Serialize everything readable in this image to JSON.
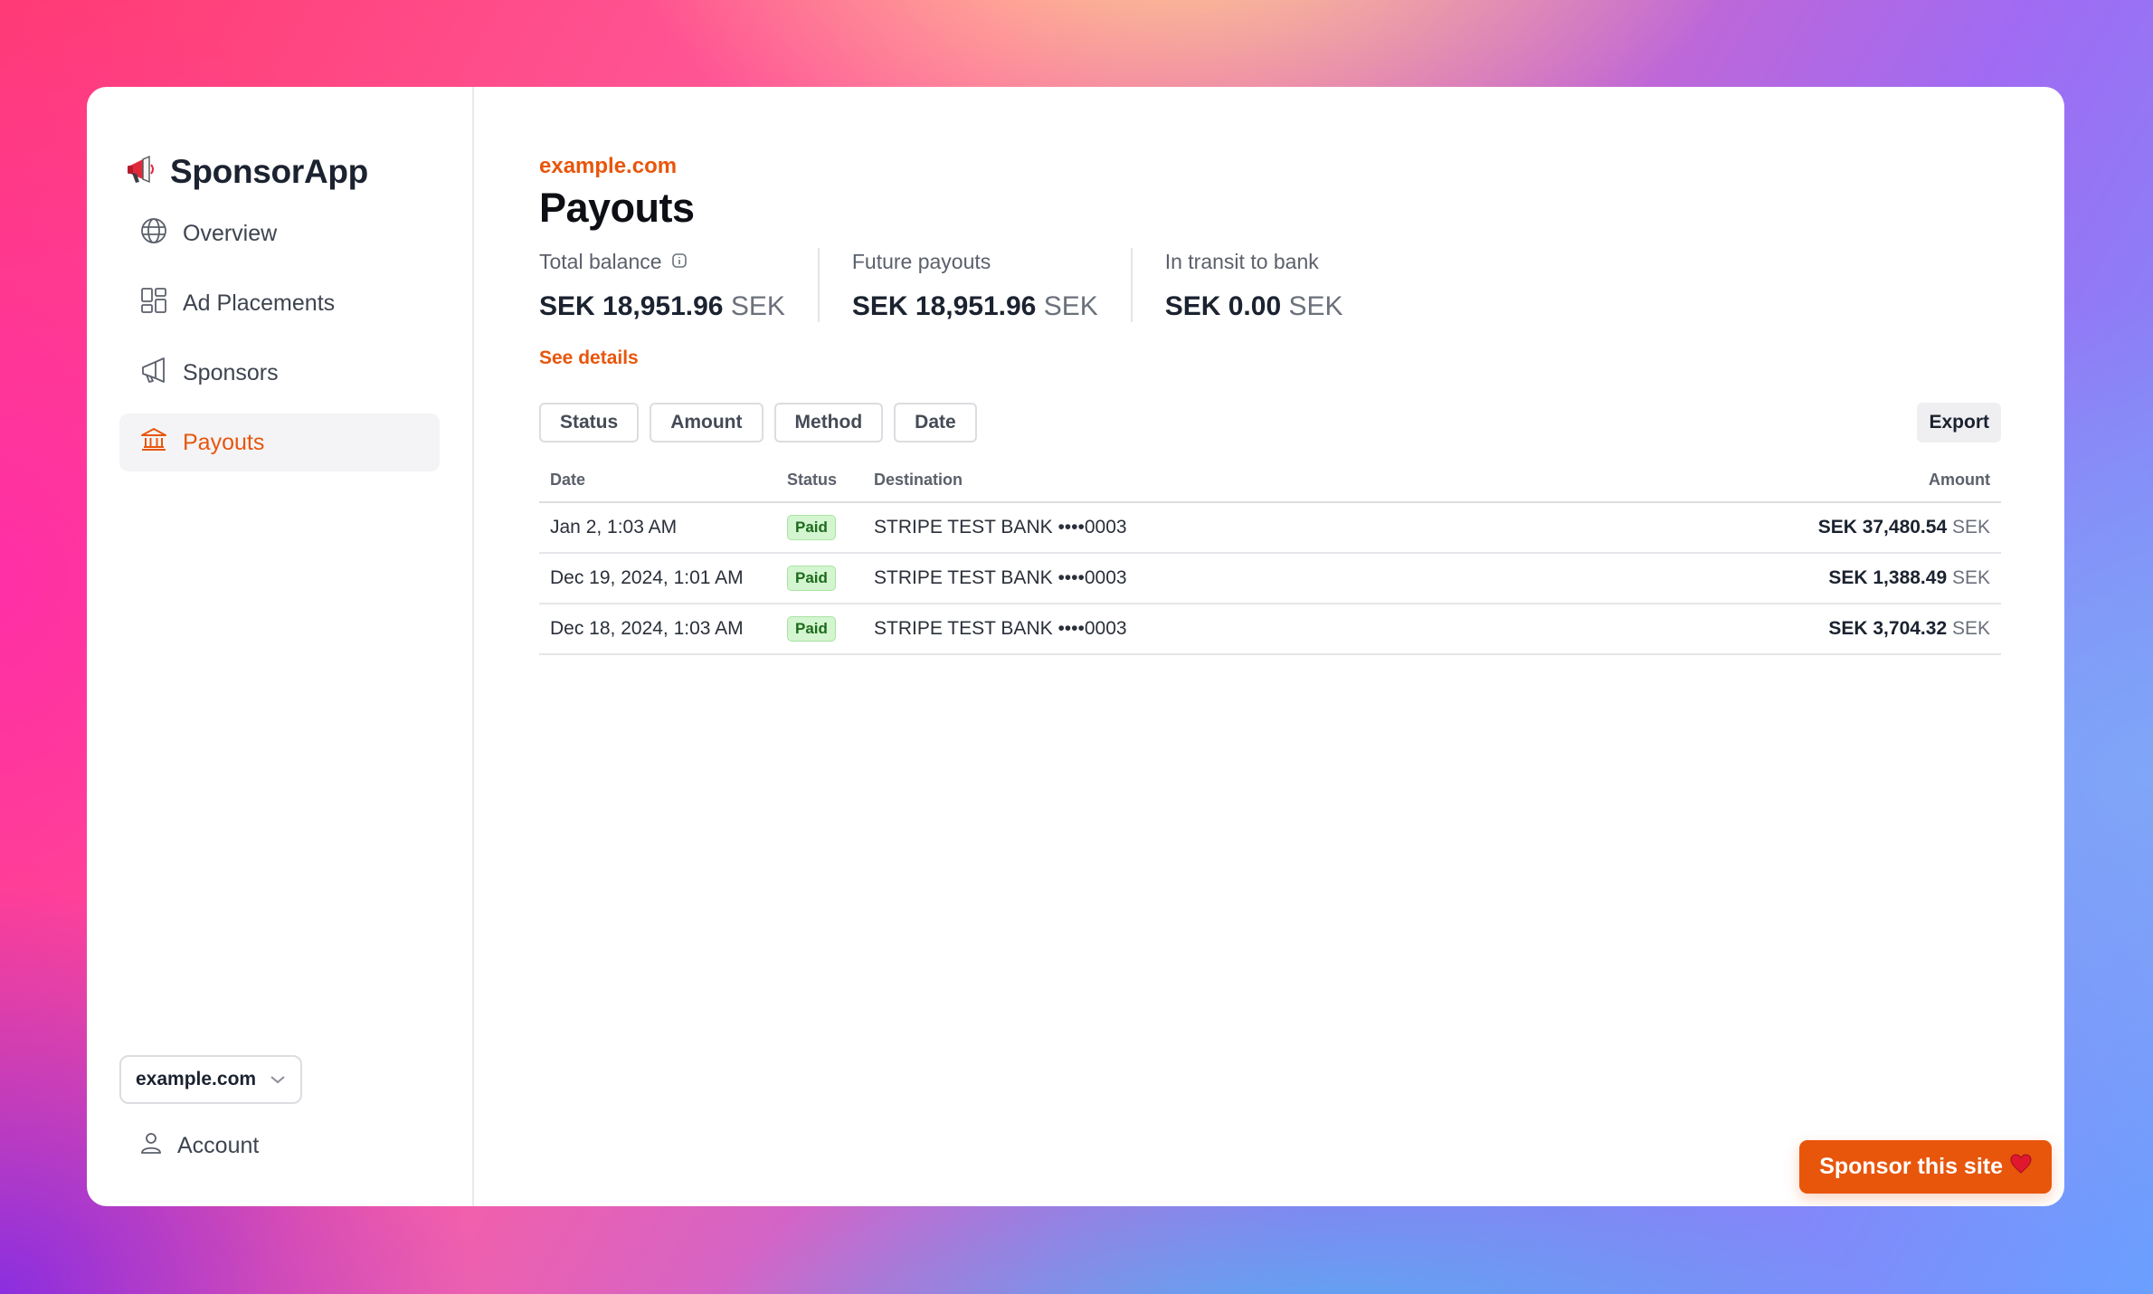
{
  "app": {
    "title": "SponsorApp",
    "logo_icon": "megaphone-icon"
  },
  "sidebar": {
    "items": [
      {
        "label": "Overview",
        "icon": "globe-icon",
        "active": false
      },
      {
        "label": "Ad Placements",
        "icon": "layout-icon",
        "active": false
      },
      {
        "label": "Sponsors",
        "icon": "megaphone-outline-icon",
        "active": false
      },
      {
        "label": "Payouts",
        "icon": "bank-icon",
        "active": true
      }
    ],
    "site_select": {
      "value": "example.com"
    },
    "account_label": "Account"
  },
  "main": {
    "site_label": "example.com",
    "title": "Payouts",
    "stats": [
      {
        "label": "Total balance",
        "value": "SEK 18,951.96",
        "currency": "SEK",
        "has_info": true
      },
      {
        "label": "Future payouts",
        "value": "SEK 18,951.96",
        "currency": "SEK",
        "has_info": false
      },
      {
        "label": "In transit to bank",
        "value": "SEK 0.00",
        "currency": "SEK",
        "has_info": false
      }
    ],
    "see_details": "See details",
    "filters": [
      "Status",
      "Amount",
      "Method",
      "Date"
    ],
    "export_label": "Export",
    "table": {
      "headers": {
        "date": "Date",
        "status": "Status",
        "destination": "Destination",
        "amount": "Amount"
      },
      "rows": [
        {
          "date": "Jan 2, 1:03 AM",
          "status": "Paid",
          "destination": "STRIPE TEST BANK ••••0003",
          "amount": "SEK 37,480.54",
          "currency": "SEK"
        },
        {
          "date": "Dec 19, 2024, 1:01 AM",
          "status": "Paid",
          "destination": "STRIPE TEST BANK ••••0003",
          "amount": "SEK 1,388.49",
          "currency": "SEK"
        },
        {
          "date": "Dec 18, 2024, 1:03 AM",
          "status": "Paid",
          "destination": "STRIPE TEST BANK ••••0003",
          "amount": "SEK 3,704.32",
          "currency": "SEK"
        }
      ]
    }
  },
  "sponsor_button": {
    "label": "Sponsor this site",
    "icon": "heart-icon"
  },
  "colors": {
    "accent": "#e8560c",
    "badge_bg": "#d3f5cf",
    "badge_text": "#1c6b1c"
  }
}
